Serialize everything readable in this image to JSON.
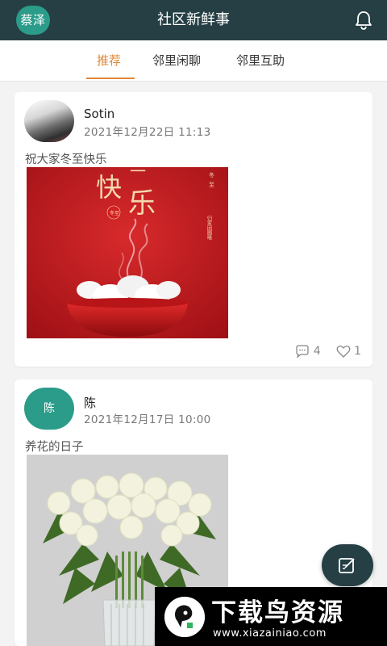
{
  "header": {
    "avatar_text": "蔡泽钒",
    "title": "社区新鲜事",
    "bell_icon": "bell-icon"
  },
  "tabs": [
    {
      "label": "推荐",
      "active": true
    },
    {
      "label": "邻里闲聊",
      "active": false
    },
    {
      "label": "邻里互助",
      "active": false
    }
  ],
  "posts": [
    {
      "author": "Sotin",
      "time": "2021年12月22日 11:13",
      "content": "祝大家冬至快乐",
      "image": {
        "big_text_1": "快",
        "big_text_2": "乐",
        "small_1": "冬",
        "small_2": "至",
        "seal": "冬至",
        "vertical": "归家团圆曦"
      },
      "comments": "4",
      "likes": "1"
    },
    {
      "author": "陈",
      "avatar_text": "陈",
      "time": "2021年12月17日 10:00",
      "content": "养花的日子"
    }
  ],
  "fab_icon": "compose-icon",
  "watermark": {
    "title": "下载鸟资源",
    "url": "www.xiazainiao.com"
  },
  "colors": {
    "header_bg": "#263f44",
    "accent": "#e0883a",
    "avatar_bg": "#2b9c8a"
  }
}
